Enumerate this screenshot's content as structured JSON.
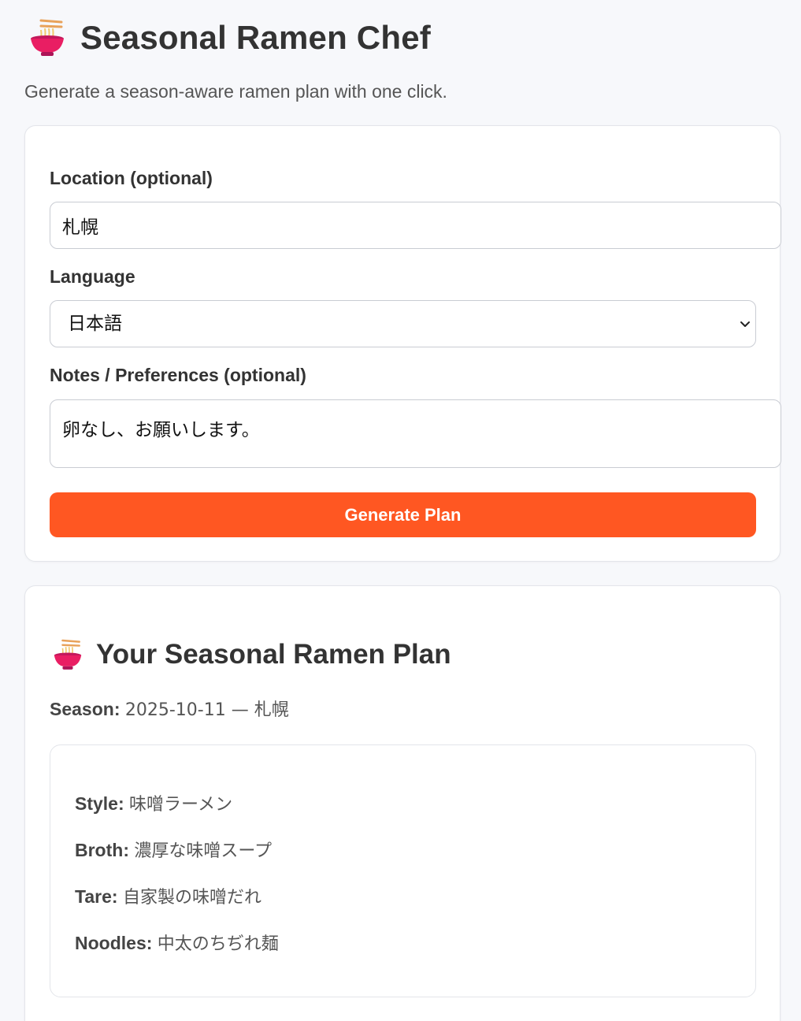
{
  "app": {
    "icon": "ramen-bowl-icon",
    "title": "Seasonal Ramen Chef",
    "subtitle": "Generate a season-aware ramen plan with one click."
  },
  "form": {
    "location_label": "Location (optional)",
    "location_value": "札幌",
    "language_label": "Language",
    "language_value": "日本語",
    "notes_label": "Notes / Preferences (optional)",
    "notes_value": "卵なし、お願いします。",
    "generate_label": "Generate Plan"
  },
  "plan": {
    "icon": "ramen-bowl-icon",
    "title": "Your Seasonal Ramen Plan",
    "season_label": "Season:",
    "season_value": "2025-10-11 — 札幌",
    "rows": [
      {
        "label": "Style:",
        "value": "味噌ラーメン"
      },
      {
        "label": "Broth:",
        "value": "濃厚な味噌スープ"
      },
      {
        "label": "Tare:",
        "value": "自家製の味噌だれ"
      },
      {
        "label": "Noodles:",
        "value": "中太のちぢれ麺"
      }
    ]
  },
  "colors": {
    "accent": "#ff5722",
    "background": "#f7f8fb",
    "card": "#ffffff",
    "text": "#333333"
  }
}
